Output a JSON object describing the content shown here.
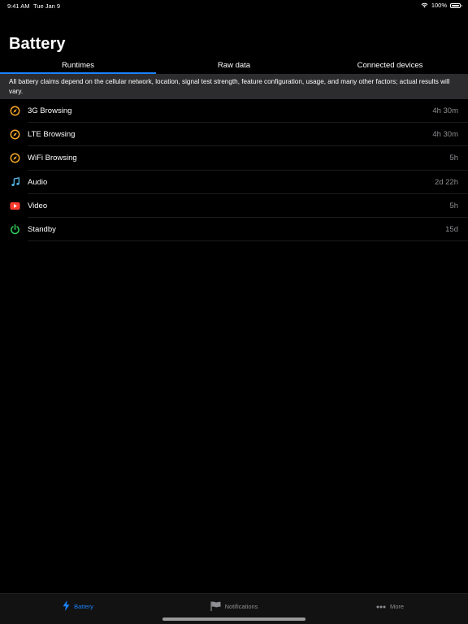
{
  "status_bar": {
    "time": "9:41 AM",
    "date": "Tue Jan 9",
    "battery_percent": "100%"
  },
  "title": "Battery",
  "tabs": [
    {
      "label": "Runtimes",
      "active": true
    },
    {
      "label": "Raw data",
      "active": false
    },
    {
      "label": "Connected devices",
      "active": false
    }
  ],
  "disclaimer": "All battery claims depend on the cellular network, location, signal test strength, feature configuration, usage, and many other factors; actual results will vary.",
  "runtimes": [
    {
      "label": "3G Browsing",
      "value": "4h 30m",
      "icon": "compass-icon"
    },
    {
      "label": "LTE Browsing",
      "value": "4h 30m",
      "icon": "compass-icon"
    },
    {
      "label": "WiFi Browsing",
      "value": "5h",
      "icon": "compass-icon"
    },
    {
      "label": "Audio",
      "value": "2d 22h",
      "icon": "music-note-icon"
    },
    {
      "label": "Video",
      "value": "5h",
      "icon": "video-play-icon"
    },
    {
      "label": "Standby",
      "value": "15d",
      "icon": "power-icon"
    }
  ],
  "tab_bar": [
    {
      "label": "Battery",
      "icon": "bolt-icon",
      "active": true
    },
    {
      "label": "Notifications",
      "icon": "flag-icon",
      "active": false
    },
    {
      "label": "More",
      "icon": "ellipsis-icon",
      "active": false
    }
  ],
  "colors": {
    "accent": "#1a84ff",
    "compass": "#f5a524",
    "music": "#5ac8fa",
    "video": "#ff3b30",
    "power": "#30d158",
    "secondary_text": "#8e8e93"
  }
}
